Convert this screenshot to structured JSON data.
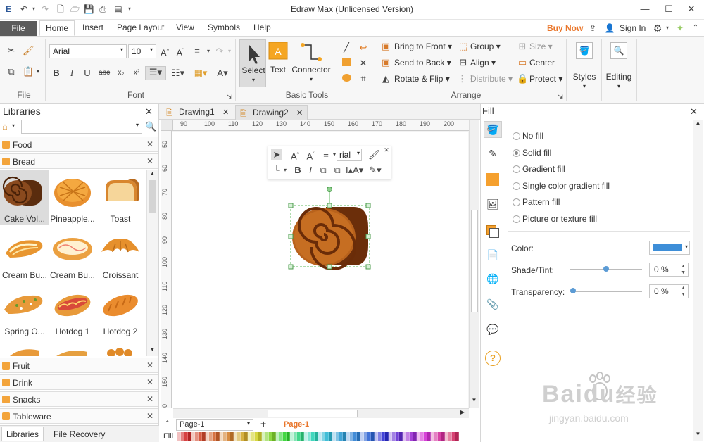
{
  "app": {
    "title": "Edraw Max (Unlicensed Version)"
  },
  "menu": {
    "file": "File",
    "tabs": [
      "Home",
      "Insert",
      "Page Layout",
      "View",
      "Symbols",
      "Help"
    ],
    "buy_now": "Buy Now",
    "sign_in": "Sign In"
  },
  "ribbon": {
    "groups": {
      "file": "File",
      "font": "Font",
      "basic_tools": "Basic Tools",
      "arrange": "Arrange"
    },
    "font_name": "Arial",
    "font_size": "10",
    "basic_tools": {
      "select": "Select",
      "text": "Text",
      "connector": "Connector"
    },
    "arrange": {
      "bring_to_front": "Bring to Front",
      "send_to_back": "Send to Back",
      "rotate_flip": "Rotate & Flip",
      "group": "Group",
      "align": "Align",
      "distribute": "Distribute",
      "size": "Size",
      "center": "Center",
      "protect": "Protect"
    },
    "styles": "Styles",
    "editing": "Editing"
  },
  "libraries": {
    "title": "Libraries",
    "search_placeholder": "",
    "categories_top": [
      "Food",
      "Bread"
    ],
    "shapes": [
      {
        "label": "Cake Vol...",
        "icon": "cake-roll"
      },
      {
        "label": "Pineapple...",
        "icon": "pineapple-bun"
      },
      {
        "label": "Toast",
        "icon": "toast"
      },
      {
        "label": "Cream Bu...",
        "icon": "cream-bun"
      },
      {
        "label": "Cream Bu...",
        "icon": "cream-bun-2"
      },
      {
        "label": "Croissant",
        "icon": "croissant"
      },
      {
        "label": "Spring O...",
        "icon": "spring-onion-bread"
      },
      {
        "label": "Hotdog 1",
        "icon": "hotdog-1"
      },
      {
        "label": "Hotdog 2",
        "icon": "hotdog-2"
      }
    ],
    "categories_bottom": [
      "Fruit",
      "Drink",
      "Snacks",
      "Tableware"
    ],
    "bottom_tabs": [
      "Libraries",
      "File Recovery"
    ]
  },
  "documents": {
    "tabs": [
      "Drawing1",
      "Drawing2"
    ],
    "active_tab": "Drawing2"
  },
  "rulers": {
    "horizontal": [
      "90",
      "100",
      "110",
      "120",
      "130",
      "140",
      "150",
      "160",
      "170",
      "180",
      "190",
      "200"
    ],
    "vertical": [
      "50",
      "60",
      "70",
      "80",
      "90",
      "100",
      "110",
      "120",
      "130",
      "140",
      "150",
      "60"
    ]
  },
  "floating_toolbar": {
    "font_name": "rial"
  },
  "pages": {
    "current": "Page-1",
    "tab": "Page-1",
    "fill_label": "Fill"
  },
  "fill_panel": {
    "title": "Fill",
    "options": [
      "No fill",
      "Solid fill",
      "Gradient fill",
      "Single color gradient fill",
      "Pattern fill",
      "Picture or texture fill"
    ],
    "selected_option": "Solid fill",
    "color_label": "Color:",
    "color_value": "#3d8ed8",
    "shade_label": "Shade/Tint:",
    "shade_value": "0 %",
    "shade_level": 0.5,
    "transparency_label": "Transparency:",
    "transparency_value": "0 %",
    "transparency_level": 0
  },
  "watermark": {
    "brand": "Baidu",
    "brand_cn": "经验",
    "url": "jingyan.baidu.com"
  },
  "colors": {
    "accent_orange": "#e9762b",
    "file_tab": "#5b5b5b",
    "selection_green": "#5cb85c",
    "bread_brown": "#7a3b12",
    "bread_orange": "#d27a2a"
  }
}
